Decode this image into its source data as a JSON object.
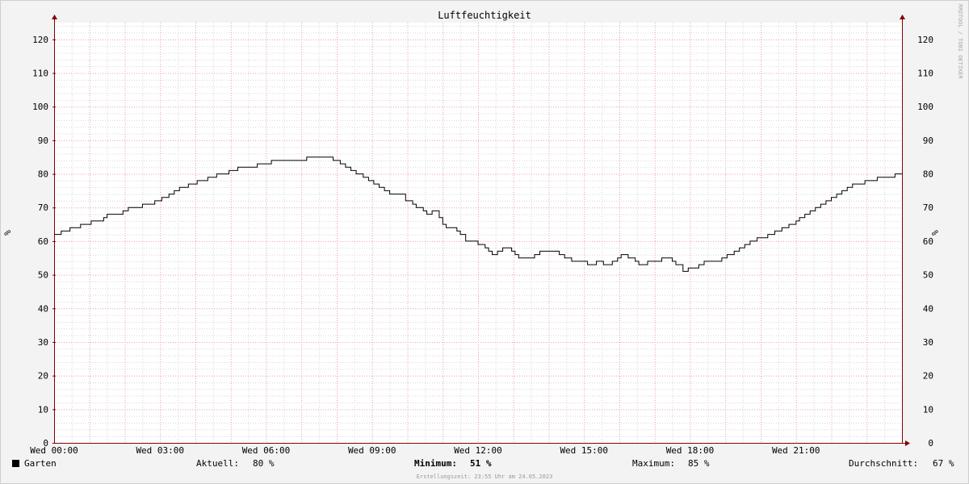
{
  "chart_data": {
    "type": "line",
    "title": "Luftfeuchtigkeit",
    "ylabel": "%",
    "ylabel_right": "%",
    "ylim": [
      0,
      125
    ],
    "yticks": [
      0,
      10,
      20,
      30,
      40,
      50,
      60,
      70,
      80,
      90,
      100,
      110,
      120
    ],
    "xlim": [
      0,
      24
    ],
    "xticks": [
      {
        "hour": 0,
        "label": "Wed 00:00"
      },
      {
        "hour": 3,
        "label": "Wed 03:00"
      },
      {
        "hour": 6,
        "label": "Wed 06:00"
      },
      {
        "hour": 9,
        "label": "Wed 09:00"
      },
      {
        "hour": 12,
        "label": "Wed 12:00"
      },
      {
        "hour": 15,
        "label": "Wed 15:00"
      },
      {
        "hour": 18,
        "label": "Wed 18:00"
      },
      {
        "hour": 21,
        "label": "Wed 21:00"
      }
    ],
    "grid": true,
    "series": [
      {
        "name": "Garten",
        "color": "#000000",
        "points": [
          [
            0,
            62
          ],
          [
            0.2,
            63
          ],
          [
            0.45,
            64
          ],
          [
            0.75,
            65
          ],
          [
            1.05,
            66
          ],
          [
            1.4,
            67
          ],
          [
            1.5,
            68
          ],
          [
            1.95,
            69
          ],
          [
            2.1,
            70
          ],
          [
            2.35,
            70
          ],
          [
            2.5,
            71
          ],
          [
            2.85,
            72
          ],
          [
            3.05,
            73
          ],
          [
            3.25,
            74
          ],
          [
            3.4,
            75
          ],
          [
            3.55,
            76
          ],
          [
            3.8,
            77
          ],
          [
            4.05,
            78
          ],
          [
            4.35,
            79
          ],
          [
            4.6,
            80
          ],
          [
            4.95,
            81
          ],
          [
            5.2,
            82
          ],
          [
            5.75,
            83
          ],
          [
            6.15,
            84
          ],
          [
            7.15,
            85
          ],
          [
            7.9,
            84
          ],
          [
            8.1,
            83
          ],
          [
            8.25,
            82
          ],
          [
            8.4,
            81
          ],
          [
            8.55,
            80
          ],
          [
            8.75,
            79
          ],
          [
            8.9,
            78
          ],
          [
            9.05,
            77
          ],
          [
            9.2,
            76
          ],
          [
            9.35,
            75
          ],
          [
            9.5,
            74
          ],
          [
            9.8,
            74
          ],
          [
            9.95,
            72
          ],
          [
            10.15,
            71
          ],
          [
            10.25,
            70
          ],
          [
            10.45,
            69
          ],
          [
            10.55,
            68
          ],
          [
            10.7,
            69
          ],
          [
            10.9,
            67
          ],
          [
            11,
            65
          ],
          [
            11.1,
            64
          ],
          [
            11.4,
            63
          ],
          [
            11.5,
            62
          ],
          [
            11.65,
            60
          ],
          [
            12,
            59
          ],
          [
            12.2,
            58
          ],
          [
            12.3,
            57
          ],
          [
            12.4,
            56
          ],
          [
            12.55,
            57
          ],
          [
            12.7,
            58
          ],
          [
            12.95,
            57
          ],
          [
            13.05,
            56
          ],
          [
            13.15,
            55
          ],
          [
            13.6,
            56
          ],
          [
            13.75,
            57
          ],
          [
            14.3,
            56
          ],
          [
            14.45,
            55
          ],
          [
            14.65,
            54
          ],
          [
            15.1,
            53
          ],
          [
            15.35,
            54
          ],
          [
            15.55,
            53
          ],
          [
            15.8,
            54
          ],
          [
            15.95,
            55
          ],
          [
            16.05,
            56
          ],
          [
            16.25,
            55
          ],
          [
            16.45,
            54
          ],
          [
            16.55,
            53
          ],
          [
            16.8,
            54
          ],
          [
            17.2,
            55
          ],
          [
            17.5,
            54
          ],
          [
            17.6,
            53
          ],
          [
            17.8,
            51
          ],
          [
            17.95,
            52
          ],
          [
            18.25,
            53
          ],
          [
            18.4,
            54
          ],
          [
            18.9,
            55
          ],
          [
            19.05,
            56
          ],
          [
            19.25,
            57
          ],
          [
            19.4,
            58
          ],
          [
            19.55,
            59
          ],
          [
            19.7,
            60
          ],
          [
            19.9,
            61
          ],
          [
            20.2,
            62
          ],
          [
            20.4,
            63
          ],
          [
            20.6,
            64
          ],
          [
            20.8,
            65
          ],
          [
            21,
            66
          ],
          [
            21.1,
            67
          ],
          [
            21.25,
            68
          ],
          [
            21.4,
            69
          ],
          [
            21.55,
            70
          ],
          [
            21.7,
            71
          ],
          [
            21.85,
            72
          ],
          [
            22,
            73
          ],
          [
            22.15,
            74
          ],
          [
            22.3,
            75
          ],
          [
            22.45,
            76
          ],
          [
            22.6,
            77
          ],
          [
            22.95,
            78
          ],
          [
            23.3,
            79
          ],
          [
            23.5,
            79
          ],
          [
            23.8,
            80
          ],
          [
            24,
            80
          ]
        ]
      }
    ]
  },
  "footer": {
    "legend_label": "Garten",
    "legend_color": "#000000",
    "current_label": "Aktuell:",
    "current_value": "80 %",
    "minimum_label": "Minimum:",
    "minimum_value": "51 %",
    "maximum_label": "Maximum:",
    "maximum_value": "85 %",
    "average_label": "Durchschnitt:",
    "average_value": "67 %",
    "credit": "Erstellungszeit: 23:55 Uhr am 24.05.2023"
  },
  "watermark": "RRDTOOL / TOBI OETIKER",
  "colors": {
    "background": "#f3f3f3",
    "plot_background": "#ffffff",
    "major_grid": "#e8a0a8",
    "minor_grid": "#d8d8d8",
    "axis": "#800000"
  }
}
